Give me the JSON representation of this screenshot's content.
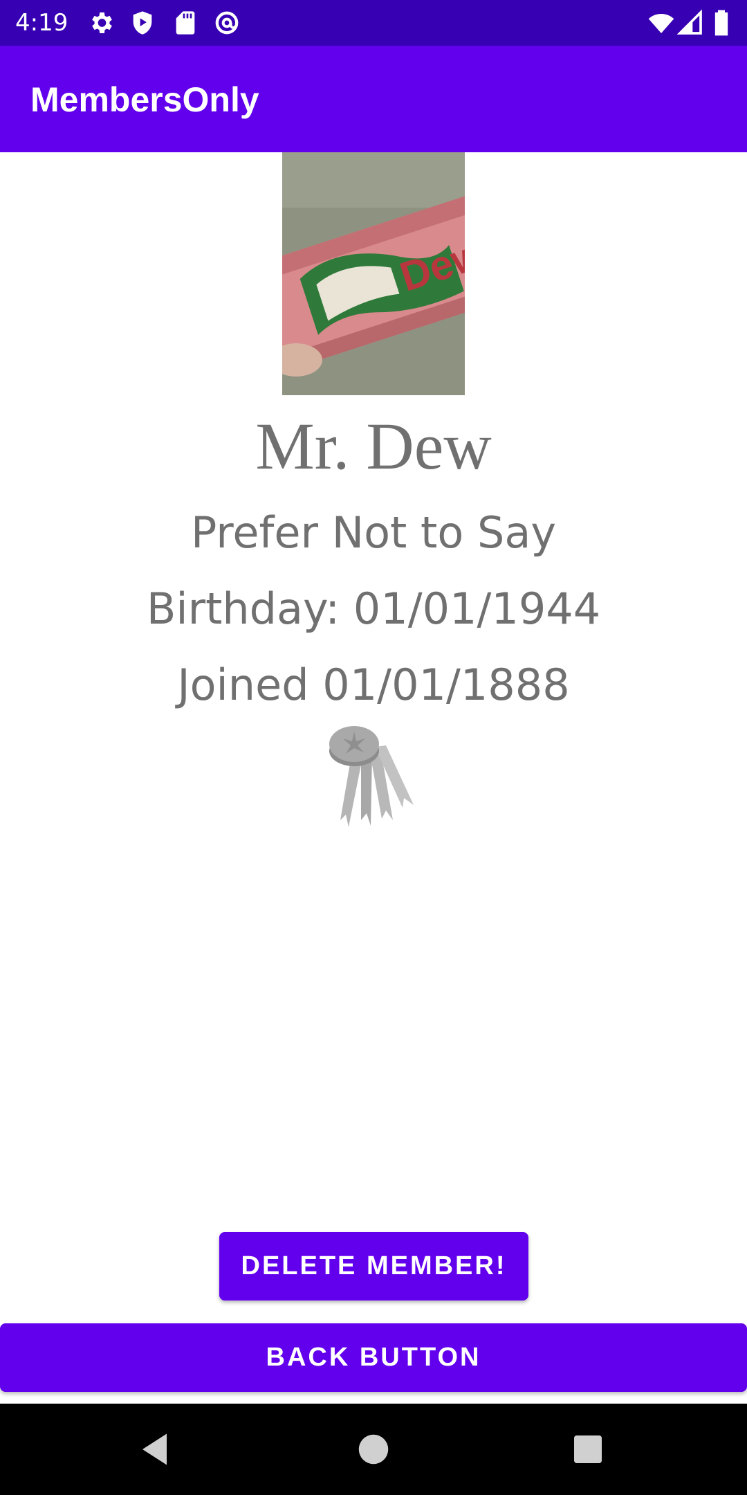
{
  "status_bar": {
    "time": "4:19",
    "left_icons": [
      "settings-icon",
      "shield-play-icon",
      "sd-card-icon",
      "at-sign-icon"
    ],
    "right_icons": [
      "wifi-icon",
      "signal-icon",
      "battery-icon"
    ]
  },
  "app_bar": {
    "title": "MembersOnly"
  },
  "member": {
    "photo_icon": "member-photo",
    "name": "Mr. Dew",
    "gender": "Prefer Not to Say",
    "birthday": "Birthday: 01/01/1944",
    "joined": "Joined 01/01/1888",
    "badge_icon": "medal-icon"
  },
  "actions": {
    "delete_label": "DELETE MEMBER!",
    "back_label": "BACK BUTTON"
  },
  "nav_bar": {
    "icons": [
      "back-triangle-icon",
      "home-circle-icon",
      "recents-square-icon"
    ]
  },
  "colors": {
    "primary": "#6200EE",
    "primary_dark": "#3700B3",
    "text_gray": "#707070"
  }
}
